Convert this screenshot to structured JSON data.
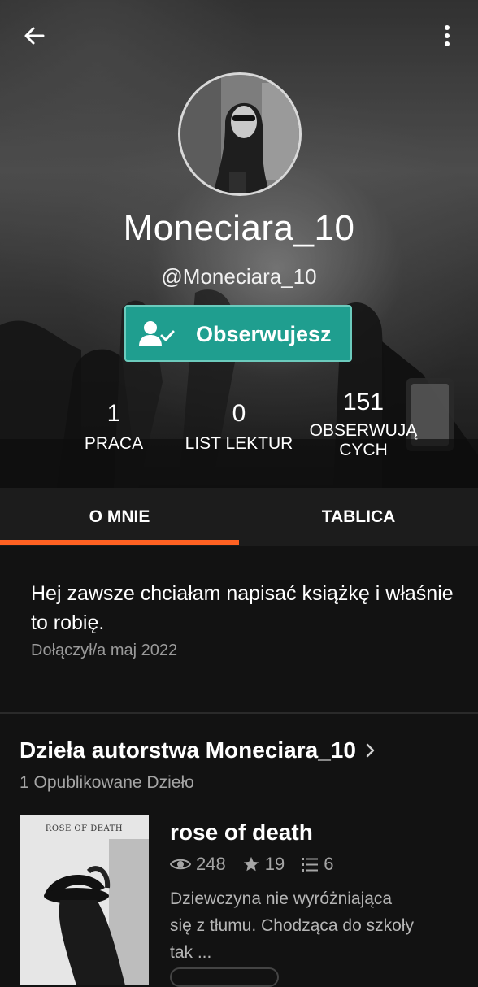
{
  "profile": {
    "username": "Moneciara_10",
    "handle": "@Moneciara_10",
    "follow_label": "Obserwujesz"
  },
  "stats": [
    {
      "value": "1",
      "label": "PRACA"
    },
    {
      "value": "0",
      "label": "LIST LEKTUR"
    },
    {
      "value": "151",
      "label_line1": "OBSERWUJĄ",
      "label_line2": "CYCH"
    }
  ],
  "tabs": [
    {
      "label": "O MNIE",
      "active": true
    },
    {
      "label": "TABLICA",
      "active": false
    }
  ],
  "about": {
    "bio": "Hej zawsze chciałam napisać książkę i właśnie to robię.",
    "joined": "Dołączył/a maj 2022"
  },
  "works": {
    "title": "Dzieła autorstwa Moneciara_10",
    "subtitle": "1 Opublikowane Dzieło",
    "items": [
      {
        "cover_text": "ROSE OF DEATH",
        "title": "rose of death",
        "reads": "248",
        "votes": "19",
        "parts": "6",
        "description": "Dziewczyna nie wyróżniająca się z tłumu. Chodząca do szkoły tak ..."
      }
    ]
  },
  "colors": {
    "accent": "#ff6122",
    "follow_button": "#1f9e8f",
    "background": "#121212"
  },
  "icons": [
    "back-arrow-icon",
    "more-vertical-icon",
    "user-check-icon",
    "eye-icon",
    "star-icon",
    "list-icon",
    "chevron-right-icon"
  ]
}
